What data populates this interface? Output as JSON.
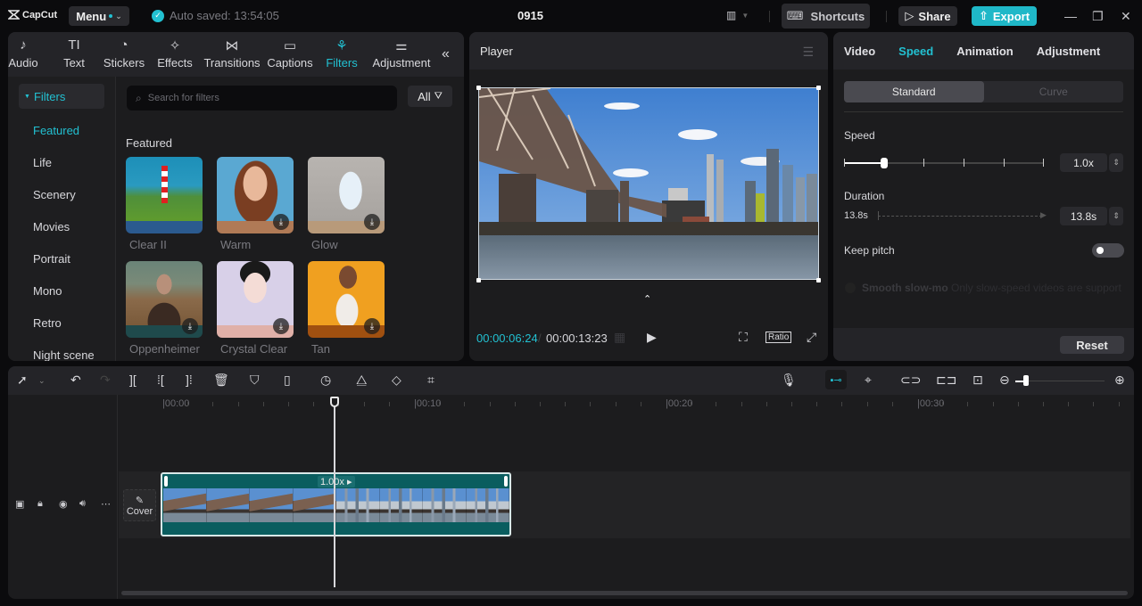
{
  "app": {
    "logo": "CapCut",
    "menu_label": "Menu",
    "autosave": "Auto saved: 13:54:05",
    "project_title": "0915",
    "shortcuts_label": "Shortcuts",
    "share_label": "Share",
    "export_label": "Export",
    "accent": "#22c1d2"
  },
  "tool_tabs": [
    {
      "label": "Audio",
      "icon": "audio-icon",
      "glyph": "♪"
    },
    {
      "label": "Text",
      "icon": "text-icon",
      "glyph": "TI"
    },
    {
      "label": "Stickers",
      "icon": "stickers-icon",
      "glyph": "◔"
    },
    {
      "label": "Effects",
      "icon": "effects-icon",
      "glyph": "✧"
    },
    {
      "label": "Transitions",
      "icon": "transitions-icon",
      "glyph": "⋈"
    },
    {
      "label": "Captions",
      "icon": "captions-icon",
      "glyph": "▭"
    },
    {
      "label": "Filters",
      "icon": "filters-icon",
      "glyph": "⚘"
    },
    {
      "label": "Adjustment",
      "icon": "adjustment-icon",
      "glyph": "⚌"
    }
  ],
  "filters_panel": {
    "group_label": "Filters",
    "categories": [
      "Featured",
      "Life",
      "Scenery",
      "Movies",
      "Portrait",
      "Mono",
      "Retro",
      "Night scene"
    ],
    "active_category": "Featured",
    "search_placeholder": "Search for filters",
    "all_label": "All",
    "section_title": "Featured",
    "items": [
      {
        "name": "Clear II",
        "downloadable": false
      },
      {
        "name": "Warm",
        "downloadable": true
      },
      {
        "name": "Glow",
        "downloadable": true
      },
      {
        "name": "Oppenheimer",
        "downloadable": true
      },
      {
        "name": "Crystal Clear",
        "downloadable": true
      },
      {
        "name": "Tan",
        "downloadable": true
      }
    ]
  },
  "player": {
    "title": "Player",
    "current_time": "00:00:06:24",
    "separator": "/",
    "total_time": "00:00:13:23",
    "ratio_label": "Ratio"
  },
  "inspector": {
    "tabs": [
      "Video",
      "Speed",
      "Animation",
      "Adjustment"
    ],
    "active_tab": "Speed",
    "modes": [
      "Standard",
      "Curve"
    ],
    "active_mode": "Standard",
    "speed_label": "Speed",
    "speed_value": "1.0x",
    "speed_slider_fraction": 0.2,
    "duration_label": "Duration",
    "duration_from": "13.8s",
    "duration_value": "13.8s",
    "keep_pitch_label": "Keep pitch",
    "keep_pitch_on": false,
    "smooth_label": "Smooth slow-mo",
    "smooth_hint": "Only slow-speed videos are support",
    "reset_label": "Reset"
  },
  "timeline": {
    "ruler": [
      "00:00",
      "00:10",
      "00:20",
      "00:30"
    ],
    "clip_speed": "1.00x",
    "cover_label": "Cover",
    "zoom_fraction": 0.12
  }
}
